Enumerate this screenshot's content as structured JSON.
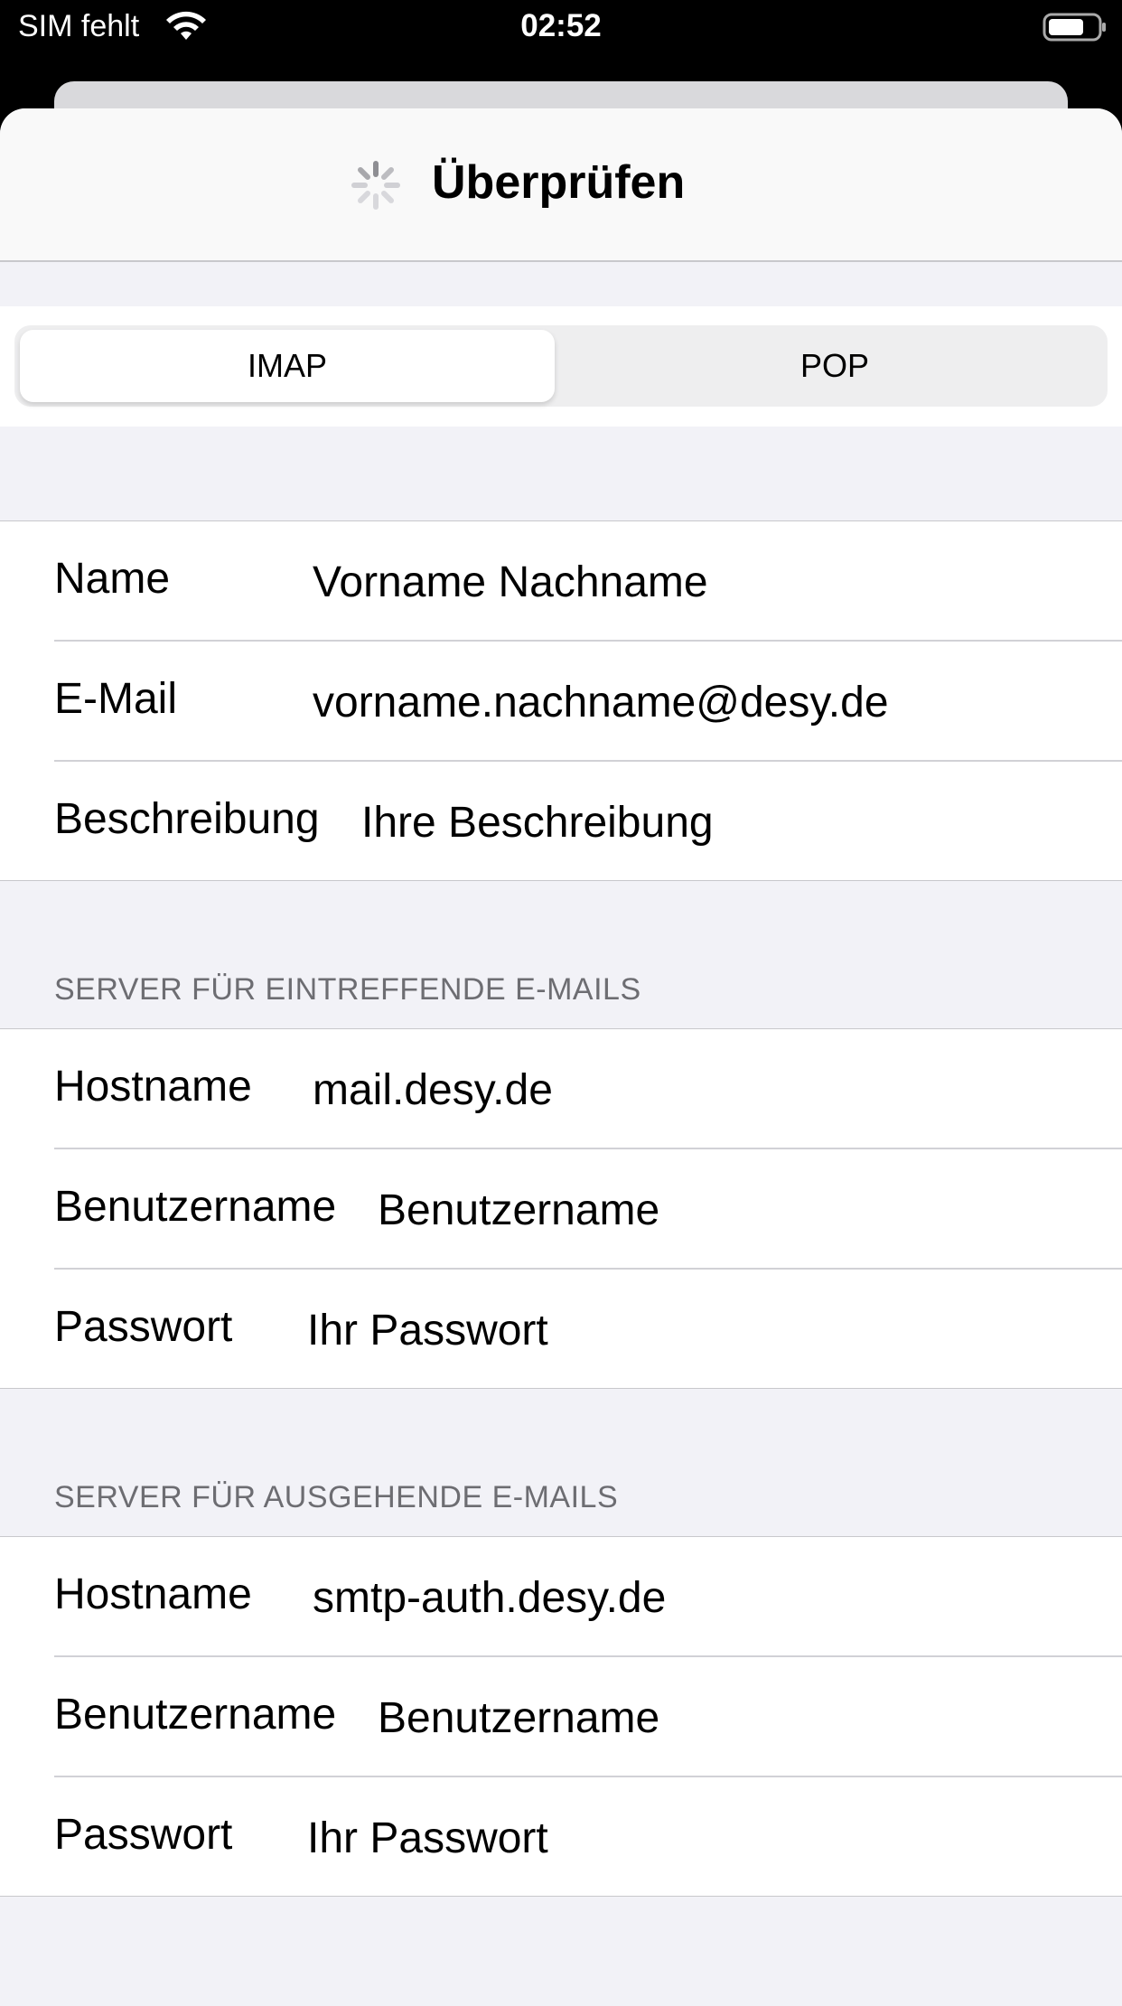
{
  "status_bar": {
    "carrier": "SIM fehlt",
    "time": "02:52"
  },
  "nav": {
    "title": "Überprüfen"
  },
  "segment": {
    "options": [
      "IMAP",
      "POP"
    ],
    "selected": "IMAP"
  },
  "account": {
    "name_label": "Name",
    "name_value": "Vorname Nachname",
    "email_label": "E-Mail",
    "email_value": "vorname.nachname@desy.de",
    "description_label": "Beschreibung",
    "description_value": "Ihre Beschreibung"
  },
  "incoming": {
    "header": "SERVER FÜR EINTREFFENDE E-MAILS",
    "hostname_label": "Hostname",
    "hostname_value": "mail.desy.de",
    "username_label": "Benutzername",
    "username_value": "Benutzername",
    "password_label": "Passwort",
    "password_placeholder": "Ihr Passwort"
  },
  "outgoing": {
    "header": "SERVER FÜR AUSGEHENDE E-MAILS",
    "hostname_label": "Hostname",
    "hostname_value": "smtp-auth.desy.de",
    "username_label": "Benutzername",
    "username_value": "Benutzername",
    "password_label": "Passwort",
    "password_placeholder": "Ihr Passwort"
  }
}
